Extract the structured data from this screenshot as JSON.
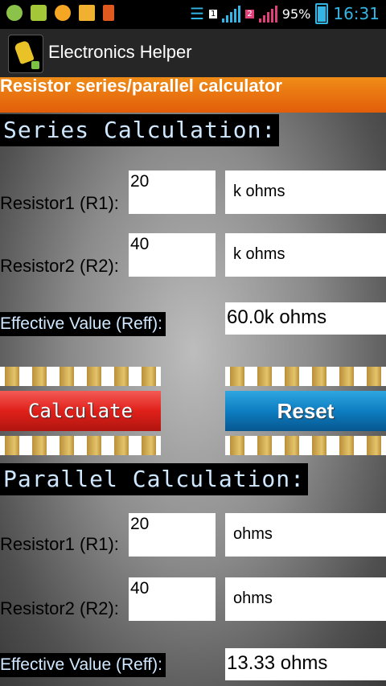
{
  "status_bar": {
    "icons": [
      "android-icon",
      "android-debug-icon",
      "sync-icon",
      "chart-icon",
      "download-icon"
    ],
    "sim1_label": "1",
    "sim2_label": "2",
    "battery": "95%",
    "time": "16:31"
  },
  "app": {
    "title": "Electronics Helper"
  },
  "banner": "Resistor series/parallel calculator",
  "series": {
    "title": "Series Calculation:",
    "r1_label": "Resistor1 (R1):",
    "r1_value": "20",
    "r1_unit": "k ohms",
    "r2_label": "Resistor2 (R2):",
    "r2_value": "40",
    "r2_unit": "k ohms",
    "eff_label": "Effective Value (Reff):",
    "eff_value": "60.0k ohms"
  },
  "buttons": {
    "calculate": "Calculate",
    "reset": "Reset"
  },
  "parallel": {
    "title": "Parallel Calculation:",
    "r1_label": "Resistor1 (R1):",
    "r1_value": "20",
    "r1_unit": "ohms",
    "r2_label": "Resistor2 (R2):",
    "r2_value": "40",
    "r2_unit": "ohms",
    "eff_label": "Effective Value (Reff):",
    "eff_value": "13.33 ohms"
  }
}
